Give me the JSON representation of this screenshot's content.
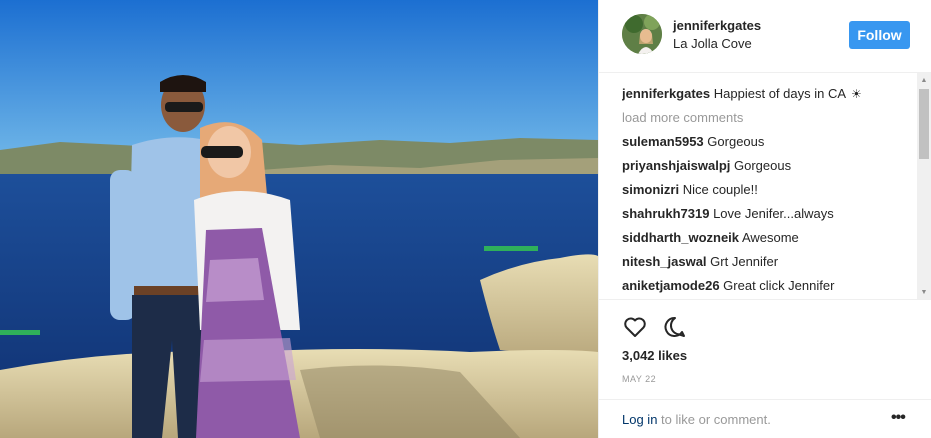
{
  "post": {
    "username": "jenniferkgates",
    "location": "La Jolla Cove",
    "follow_label": "Follow",
    "caption": {
      "user": "jenniferkgates",
      "text": "Happiest of days in CA",
      "emoji": "☀"
    },
    "load_more": "load more comments",
    "comments": [
      {
        "user": "suleman5953",
        "text": "Gorgeous"
      },
      {
        "user": "priyanshjaiswalpj",
        "text": "Gorgeous"
      },
      {
        "user": "simonizri",
        "text": "Nice couple!!"
      },
      {
        "user": "shahrukh7319",
        "text": "Love Jenifer...always"
      },
      {
        "user": "siddharth_wozneik",
        "text": "Awesome"
      },
      {
        "user": "nitesh_jaswal",
        "text": "Grt Jennifer"
      },
      {
        "user": "aniketjamode26",
        "text": "Great click Jennifer"
      }
    ],
    "likes": "3,042 likes",
    "date": "MAY 22",
    "login_link": "Log in",
    "login_suffix": " to like or comment.",
    "more_glyph": "•••",
    "icons": {
      "like": "heart-icon",
      "comment": "comment-bubble-icon",
      "more": "more-options-icon"
    },
    "colors": {
      "follow_button": "#3897f0",
      "muted_text": "#999999",
      "link": "#003569",
      "divider": "#efefef"
    }
  }
}
